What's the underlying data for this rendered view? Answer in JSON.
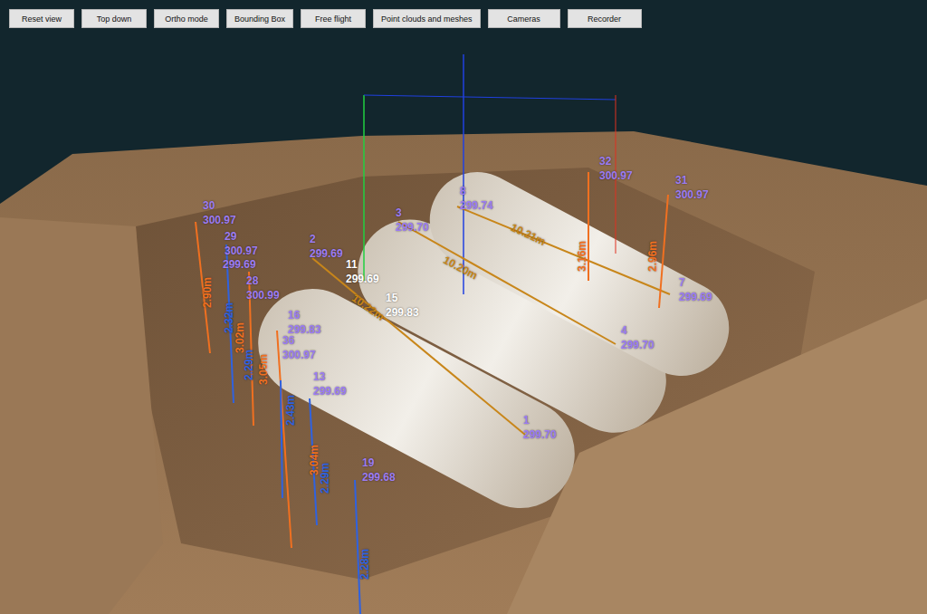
{
  "toolbar": {
    "buttons": [
      "Reset view",
      "Top down",
      "Ortho mode",
      "Bounding Box",
      "Free flight",
      "Point clouds and meshes",
      "Cameras",
      "Recorder"
    ]
  },
  "points": [
    {
      "lines": [
        "30",
        "300.97"
      ],
      "color": "#9d7cf2"
    },
    {
      "lines": [
        "29",
        "300.97"
      ],
      "color": "#9d7cf2"
    },
    {
      "lines": [
        "299.69"
      ],
      "color": "#9d7cf2"
    },
    {
      "lines": [
        "28",
        "300.99"
      ],
      "color": "#9d7cf2"
    },
    {
      "lines": [
        "2",
        "299.69"
      ],
      "color": "#9d7cf2"
    },
    {
      "lines": [
        "3",
        "299.70"
      ],
      "color": "#9d7cf2"
    },
    {
      "lines": [
        "8",
        "299.74"
      ],
      "color": "#9d7cf2"
    },
    {
      "lines": [
        "32",
        "300.97"
      ],
      "color": "#9d7cf2"
    },
    {
      "lines": [
        "31",
        "300.97"
      ],
      "color": "#9d7cf2"
    },
    {
      "lines": [
        "7",
        "299.69"
      ],
      "color": "#9d7cf2"
    },
    {
      "lines": [
        "4",
        "299.70"
      ],
      "color": "#9d7cf2"
    },
    {
      "lines": [
        "11",
        "299.69"
      ],
      "color": "#ffffff"
    },
    {
      "lines": [
        "15",
        "299.83"
      ],
      "color": "#ffffff"
    },
    {
      "lines": [
        "16",
        "299.83"
      ],
      "color": "#9d7cf2"
    },
    {
      "lines": [
        "36",
        "300.97"
      ],
      "color": "#9d7cf2"
    },
    {
      "lines": [
        "13",
        "299.69"
      ],
      "color": "#9d7cf2"
    },
    {
      "lines": [
        "19",
        "299.68"
      ],
      "color": "#9d7cf2"
    },
    {
      "lines": [
        "1",
        "299.70"
      ],
      "color": "#9d7cf2"
    }
  ],
  "measurements": [
    {
      "text": "10.20m",
      "color": "#c8861a"
    },
    {
      "text": "10.21m",
      "color": "#c8861a"
    },
    {
      "text": "10.22m",
      "color": "#c8861a"
    },
    {
      "text": "3.16m",
      "color": "#f07020"
    },
    {
      "text": "2.96m",
      "color": "#f07020"
    },
    {
      "text": "2.90m",
      "color": "#f07020"
    },
    {
      "text": "2.32m",
      "color": "#2f62e0"
    },
    {
      "text": "3.02m",
      "color": "#f07020"
    },
    {
      "text": "2.29m",
      "color": "#2f62e0"
    },
    {
      "text": "3.05m",
      "color": "#f07020"
    },
    {
      "text": "2.43m",
      "color": "#2f62e0"
    },
    {
      "text": "3.04m",
      "color": "#f07020"
    },
    {
      "text": "2.29m",
      "color": "#2f62e0"
    },
    {
      "text": "2.28m",
      "color": "#2f62e0"
    }
  ]
}
